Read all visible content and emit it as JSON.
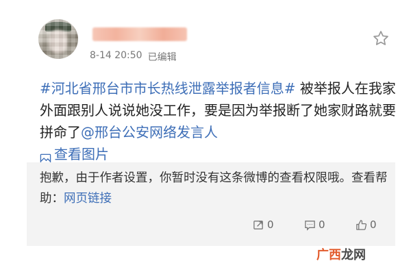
{
  "post": {
    "meta_time": "8-14 20:50",
    "meta_edited": "已编辑",
    "hashtag": "#河北省邢台市市长热线泄露举报者信息#",
    "text": " 被举报人在我家外面跟别人说说她没工作，要是因为举报断了她家财路就要拼命了",
    "mention": "@邢台公安网络发言人",
    "view_image": "查看图片"
  },
  "retweet": {
    "text_1": "抱歉，由于作者设置，你暂时没有这条微博的查看权限哦。查看帮助：",
    "help_link": "网页链接",
    "share_count": "0",
    "comment_count": "0",
    "like_count": "0"
  },
  "watermark": {
    "part1": "广西",
    "part2": "龙网"
  },
  "colors": {
    "link": "#3d6eb7",
    "retweet_bg": "#f3f3f3",
    "watermark_accent": "#e25a2b"
  },
  "icons": {
    "favorite": "star-icon",
    "image": "image-icon",
    "share": "share-icon",
    "comment": "comment-icon",
    "like": "thumbs-up-icon"
  }
}
